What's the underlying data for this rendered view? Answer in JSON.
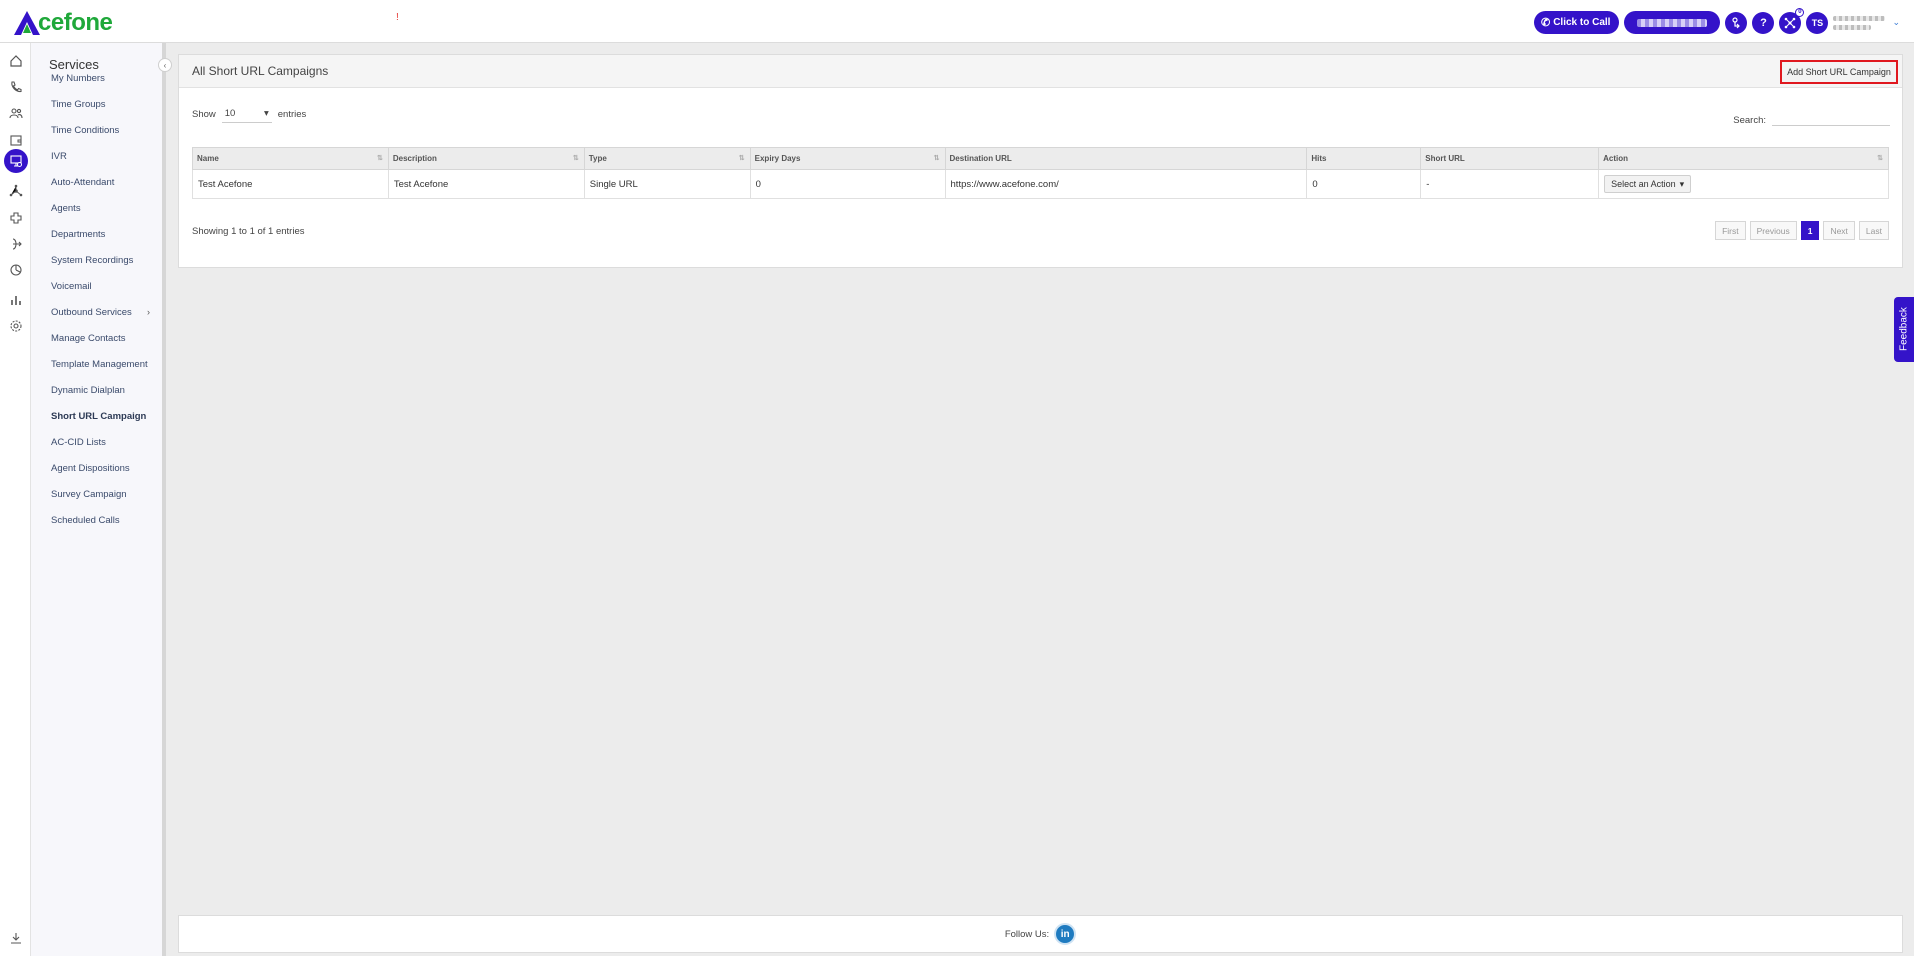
{
  "header": {
    "logo_text": "cefone",
    "red_mark": "!",
    "click_to_call": "Click to Call",
    "help_label": "?",
    "notif_badge": "0",
    "avatar_initials": "TS"
  },
  "services": {
    "title": "Services",
    "items": [
      {
        "label": "My Numbers"
      },
      {
        "label": "Time Groups"
      },
      {
        "label": "Time Conditions"
      },
      {
        "label": "IVR"
      },
      {
        "label": "Auto-Attendant"
      },
      {
        "label": "Agents"
      },
      {
        "label": "Departments"
      },
      {
        "label": "System Recordings"
      },
      {
        "label": "Voicemail"
      },
      {
        "label": "Outbound Services"
      },
      {
        "label": "Manage Contacts"
      },
      {
        "label": "Template Management"
      },
      {
        "label": "Dynamic Dialplan"
      },
      {
        "label": "Short URL Campaign"
      },
      {
        "label": "AC-CID Lists"
      },
      {
        "label": "Agent Dispositions"
      },
      {
        "label": "Survey Campaign"
      },
      {
        "label": "Scheduled Calls"
      }
    ],
    "active": "Short URL Campaign"
  },
  "panel": {
    "title": "All Short URL Campaigns",
    "add_button": "Add Short URL Campaign",
    "show_label": "Show",
    "entries_value": "10",
    "entries_label": "entries",
    "search_label": "Search:",
    "columns": [
      "Name",
      "Description",
      "Type",
      "Expiry Days",
      "Destination URL",
      "Hits",
      "Short URL",
      "Action"
    ],
    "rows": [
      {
        "name": "Test Acefone",
        "description": "Test Acefone",
        "type": "Single URL",
        "expiry_days": "0",
        "destination_url": "https://www.acefone.com/",
        "hits": "0",
        "short_url": "-",
        "action": "Select an Action"
      }
    ],
    "info": "Showing 1 to 1 of 1 entries",
    "pager": {
      "first": "First",
      "previous": "Previous",
      "current": "1",
      "next": "Next",
      "last": "Last"
    }
  },
  "feedback": "Feedback",
  "footer": {
    "follow_us": "Follow Us:",
    "linkedin": "in"
  },
  "colors": {
    "brand": "#3413c9",
    "logo_green": "#1fa83a",
    "highlight": "#e0181f"
  }
}
